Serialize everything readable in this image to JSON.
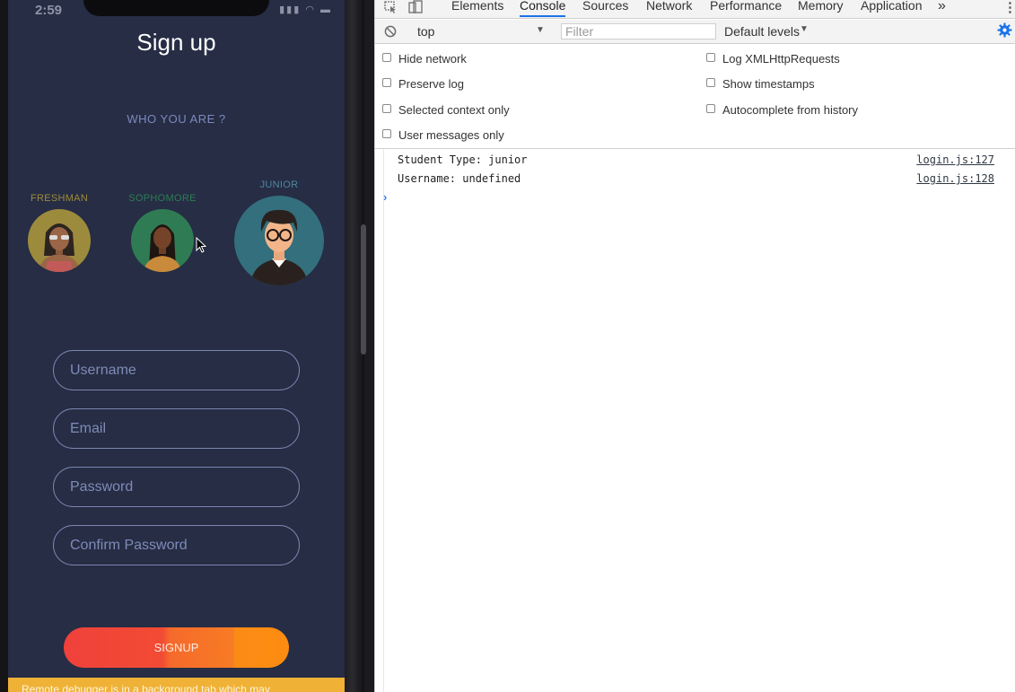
{
  "status_bar": {
    "time": "2:59"
  },
  "signup": {
    "title": "Sign up",
    "who_label": "WHO YOU ARE ?",
    "avatars": [
      {
        "label": "FRESHMAN",
        "color": "#9d8b3d"
      },
      {
        "label": "SOPHOMORE",
        "color": "#2f7c54"
      },
      {
        "label": "JUNIOR",
        "color": "#336f7c"
      }
    ],
    "fields": [
      {
        "placeholder": "Username"
      },
      {
        "placeholder": "Email"
      },
      {
        "placeholder": "Password"
      },
      {
        "placeholder": "Confirm Password"
      }
    ],
    "button_label": "SIGNUP",
    "toast": "Remote debugger is in a background tab which may"
  },
  "devtools": {
    "tabs": [
      "Elements",
      "Console",
      "Sources",
      "Network",
      "Performance",
      "Memory",
      "Application"
    ],
    "active_tab": "Console",
    "more_tabs": "»",
    "context": "top",
    "filter_placeholder": "Filter",
    "levels": "Default levels",
    "settings": {
      "left": [
        "Hide network",
        "Preserve log",
        "Selected context only",
        "User messages only"
      ],
      "right": [
        "Log XMLHttpRequests",
        "Show timestamps",
        "Autocomplete from history"
      ]
    },
    "logs": [
      {
        "message": "Student Type: junior",
        "source": "login.js:127"
      },
      {
        "message": "Username: undefined",
        "source": "login.js:128"
      }
    ],
    "prompt_symbol": "›"
  },
  "colors": {
    "screen_bg": "#262d44",
    "button_start": "#f0413b",
    "button_end": "#fd8c10",
    "toast_bg": "#efb236",
    "active_tab_underline": "#1a73e8"
  }
}
